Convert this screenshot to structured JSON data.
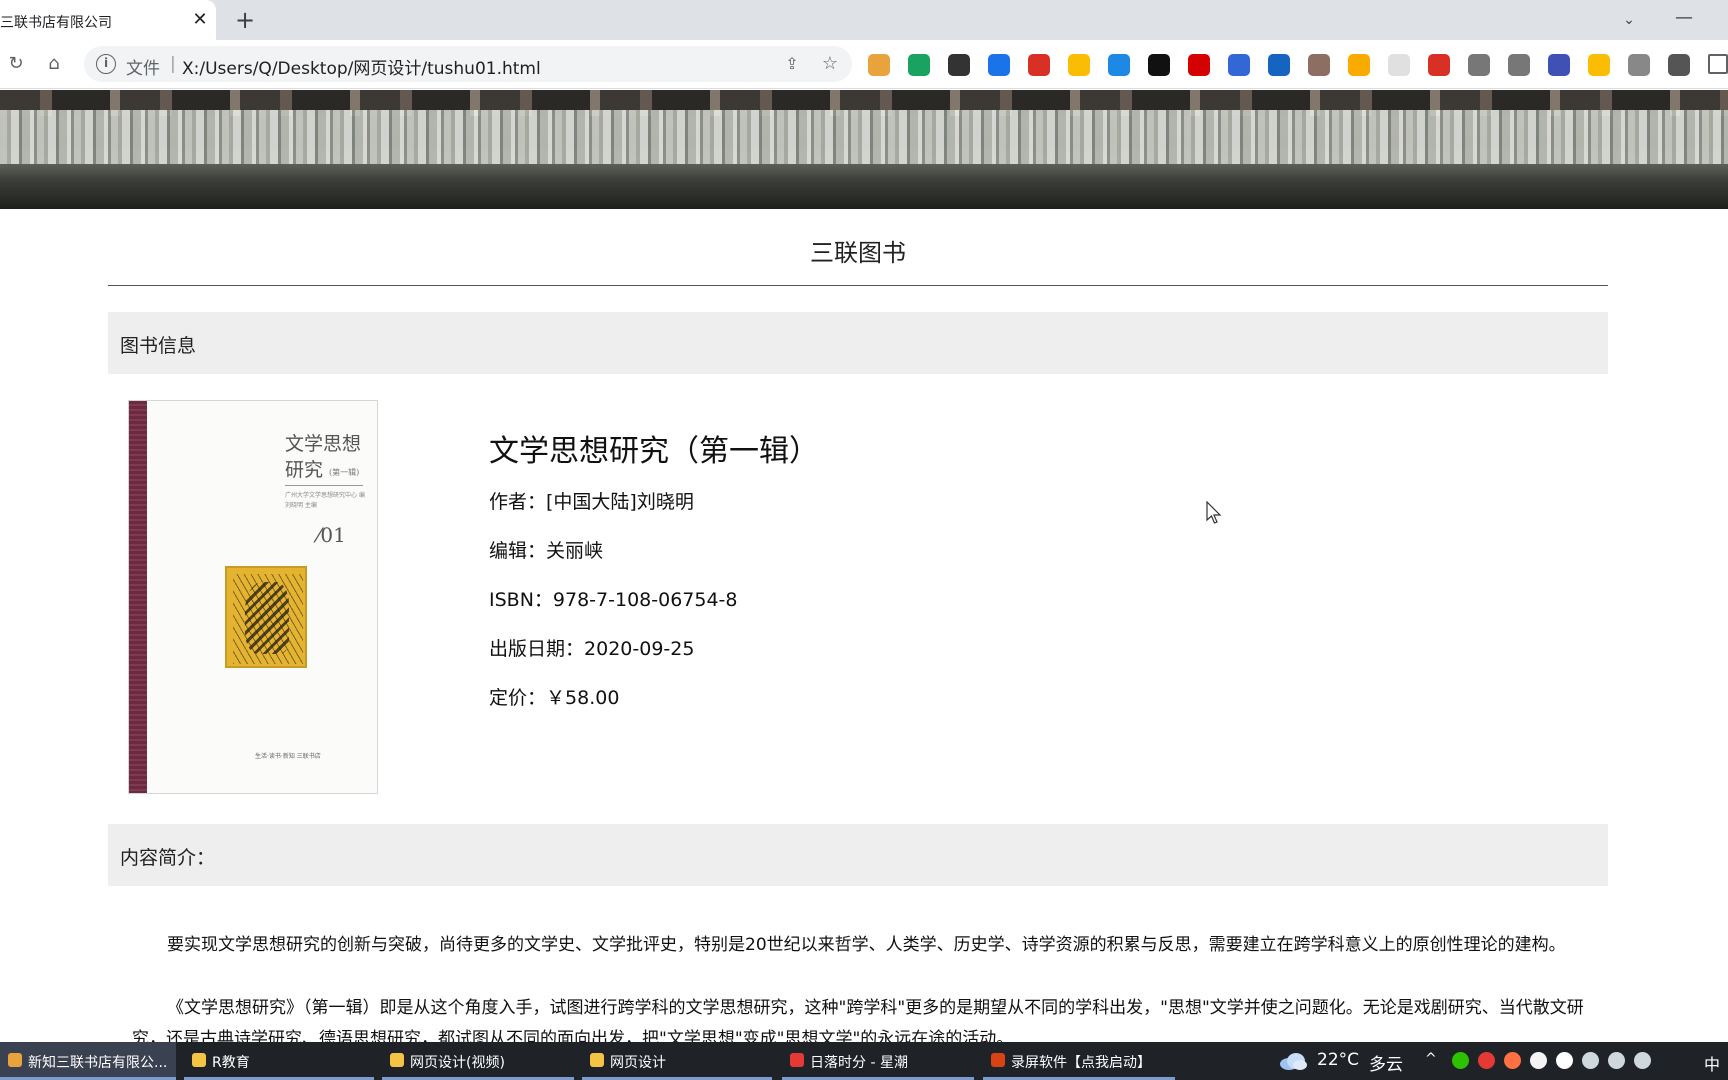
{
  "browser": {
    "tab_title": "三联书店有限公司",
    "tab_close": "✕",
    "new_tab": "+",
    "tab_search": "⌄",
    "minimize": "—",
    "reload": "↻",
    "home": "⌂",
    "address_label": "文件",
    "address_separator": "|",
    "address_url": "X:/Users/Q/Desktop/网页设计/tushu01.html",
    "info_icon": "i",
    "share_icon": "⇪",
    "star_icon": "☆",
    "extensions": [
      {
        "name": "chrome-icon",
        "color": "#e8a33d"
      },
      {
        "name": "shield-extension-icon",
        "color": "#1aa260"
      },
      {
        "name": "terminal-extension-icon",
        "color": "#333333"
      },
      {
        "name": "search-extension-icon",
        "color": "#1a73e8"
      },
      {
        "name": "fe-extension-icon",
        "color": "#d93025"
      },
      {
        "name": "chrome-extension-icon",
        "color": "#fbbc04"
      },
      {
        "name": "download-extension-icon",
        "color": "#1e88e5"
      },
      {
        "name": "openai-extension-icon",
        "color": "#111111"
      },
      {
        "name": "adblock-extension-icon",
        "color": "#d50000"
      },
      {
        "name": "g-extension-icon",
        "color": "#3367d6"
      },
      {
        "name": "y-extension-icon",
        "color": "#1565c0"
      },
      {
        "name": "owl-extension-icon",
        "color": "#8d6e63"
      },
      {
        "name": "refresh-extension-icon",
        "color": "#f9ab00"
      },
      {
        "name": "blank-extension-icon",
        "color": "#e0e0e0"
      },
      {
        "name": "tree-extension-icon",
        "color": "#d93025"
      },
      {
        "name": "cloud-extension-icon",
        "color": "#777777"
      },
      {
        "name": "camera-extension-icon",
        "color": "#777777"
      },
      {
        "name": "jh-extension-icon",
        "color": "#3f51b5"
      },
      {
        "name": "hex-extension-icon",
        "color": "#fbbc04"
      },
      {
        "name": "gear-extension-icon",
        "color": "#888888"
      },
      {
        "name": "puzzle-extension-icon",
        "color": "#555555"
      }
    ]
  },
  "page": {
    "site_title": "三联图书",
    "info_section_label": "图书信息",
    "cover": {
      "title": "文学思想研究",
      "subtitle": "(第一辑)",
      "editor_line": "广州大学文学思想研究中心 编 刘晓明 主编",
      "volume": "⁄01",
      "publisher": "生活·读书·新知 三联书店"
    },
    "book": {
      "title": "文学思想研究（第一辑）",
      "author_key": "作者：",
      "author": "[中国大陆]刘晓明",
      "editor_key": "编辑：",
      "editor": "关丽峡",
      "isbn_key": "ISBN：",
      "isbn": "978-7-108-06754-8",
      "date_key": "出版日期：",
      "date": "2020-09-25",
      "price_key": "定价：",
      "price": "￥58.00"
    },
    "intro_section_label": "内容简介：",
    "intro_paragraphs": [
      "要实现文学思想研究的创新与突破，尚待更多的文学史、文学批评史，特别是20世纪以来哲学、人类学、历史学、诗学资源的积累与反思，需要建立在跨学科意义上的原创性理论的建构。",
      "《文学思想研究》（第一辑）即是从这个角度入手，试图进行跨学科的文学思想研究，这种\"跨学科\"更多的是期望从不同的学科出发，\"思想\"文学并使之问题化。无论是戏剧研究、当代散文研究，还是古典诗学研究、德语思想研究，都试图从不同的面向出发，把\"文学思想\"变成\"思想文学\"的永远在途的活动。"
    ]
  },
  "taskbar": {
    "tasks": [
      {
        "label": "新知三联书店有限公...",
        "icon_color": "#e8a33d"
      },
      {
        "label": "R教育",
        "icon_color": "#f6c445"
      },
      {
        "label": "网页设计(视频)",
        "icon_color": "#f6c445"
      },
      {
        "label": "网页设计",
        "icon_color": "#f6c445"
      },
      {
        "label": "日落时分 - 星潮",
        "icon_color": "#e53935"
      },
      {
        "label": "录屏软件【点我启动】",
        "icon_color": "#d84315"
      }
    ],
    "temperature": "22°C",
    "weather": "多云",
    "tray_up": "^",
    "language": "中",
    "tray_icons": [
      {
        "name": "wechat-icon",
        "color": "#2dc100"
      },
      {
        "name": "record-icon",
        "color": "#e53935"
      },
      {
        "name": "speaker-app-icon",
        "color": "#ff7043"
      },
      {
        "name": "qq-icon",
        "color": "#f4f4f4"
      },
      {
        "name": "app-icon",
        "color": "#ffffff"
      },
      {
        "name": "wifi-icon",
        "color": "#cfd8dc"
      },
      {
        "name": "volume-icon",
        "color": "#cfd8dc"
      },
      {
        "name": "battery-icon",
        "color": "#cfd8dc"
      }
    ]
  }
}
